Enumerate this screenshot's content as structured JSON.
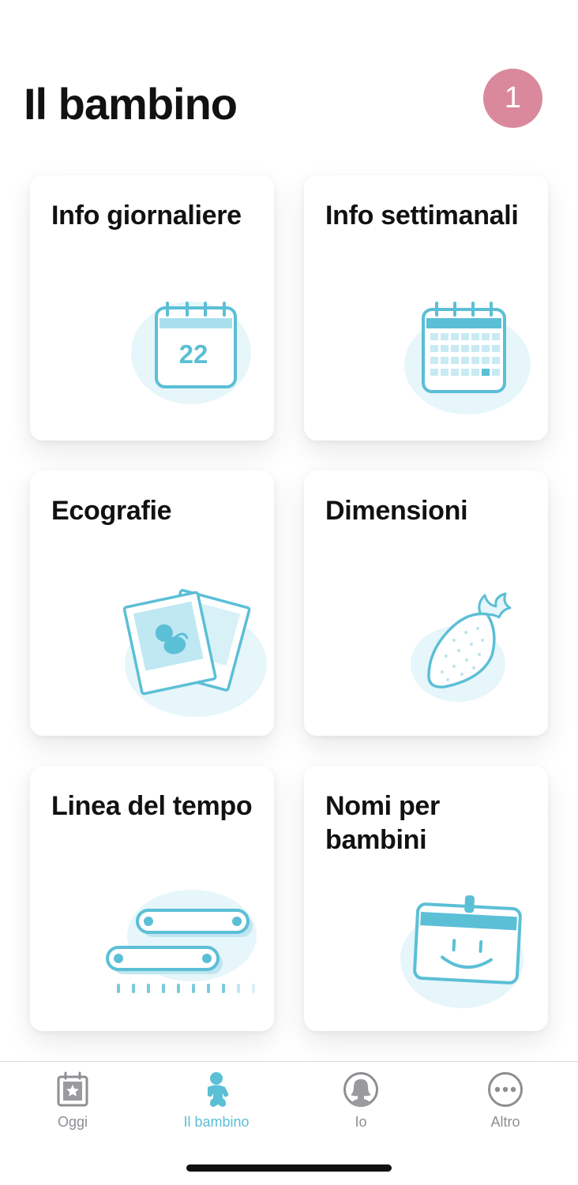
{
  "header": {
    "title": "Il bambino",
    "avatar_label": "1"
  },
  "cards": [
    {
      "title": "Info giornaliere",
      "icon": "daily-calendar-icon",
      "date_number": "22"
    },
    {
      "title": "Info settimanali",
      "icon": "weekly-calendar-icon"
    },
    {
      "title": "Ecografie",
      "icon": "ultrasound-photos-icon"
    },
    {
      "title": "Dimensioni",
      "icon": "strawberry-icon"
    },
    {
      "title": "Linea del tempo",
      "icon": "timeline-icon"
    },
    {
      "title": "Nomi per bambini",
      "icon": "name-tag-icon"
    }
  ],
  "tabbar": {
    "tabs": [
      {
        "label": "Oggi",
        "icon": "calendar-star-icon",
        "active": false
      },
      {
        "label": "Il bambino",
        "icon": "baby-icon",
        "active": true
      },
      {
        "label": "Io",
        "icon": "user-profile-icon",
        "active": false
      },
      {
        "label": "Altro",
        "icon": "more-icon",
        "active": false
      }
    ]
  },
  "colors": {
    "accent": "#5bbfd6",
    "accent_light": "#e6f6fa",
    "avatar": "#d9899b",
    "tab_inactive": "#8e8e93"
  }
}
